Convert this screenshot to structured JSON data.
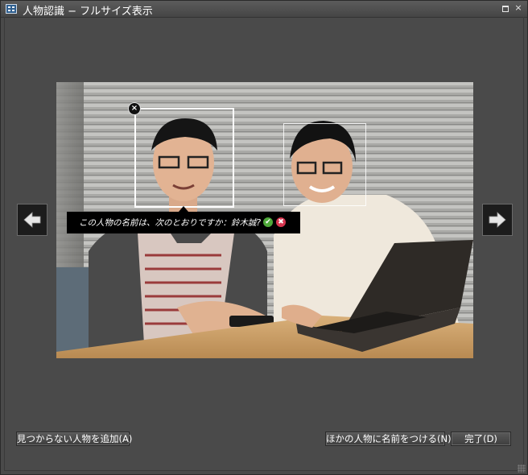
{
  "window": {
    "title": "人物認識 − フルサイズ表示",
    "maximize_label": "",
    "close_label": "×"
  },
  "navigation": {
    "prev_icon": "arrow-left-icon",
    "next_icon": "arrow-right-icon"
  },
  "photo": {
    "remove_face_label": "×",
    "prompt": {
      "text": "この人物の名前は、次のとおりですか：鈴木誠?",
      "confirm_label": "✔",
      "reject_label": "✖"
    }
  },
  "buttons": {
    "add_missing_person": "見つからない人物を追加(A)",
    "name_other_person": "ほかの人物に名前をつける(N)",
    "done": "完了(D)"
  }
}
